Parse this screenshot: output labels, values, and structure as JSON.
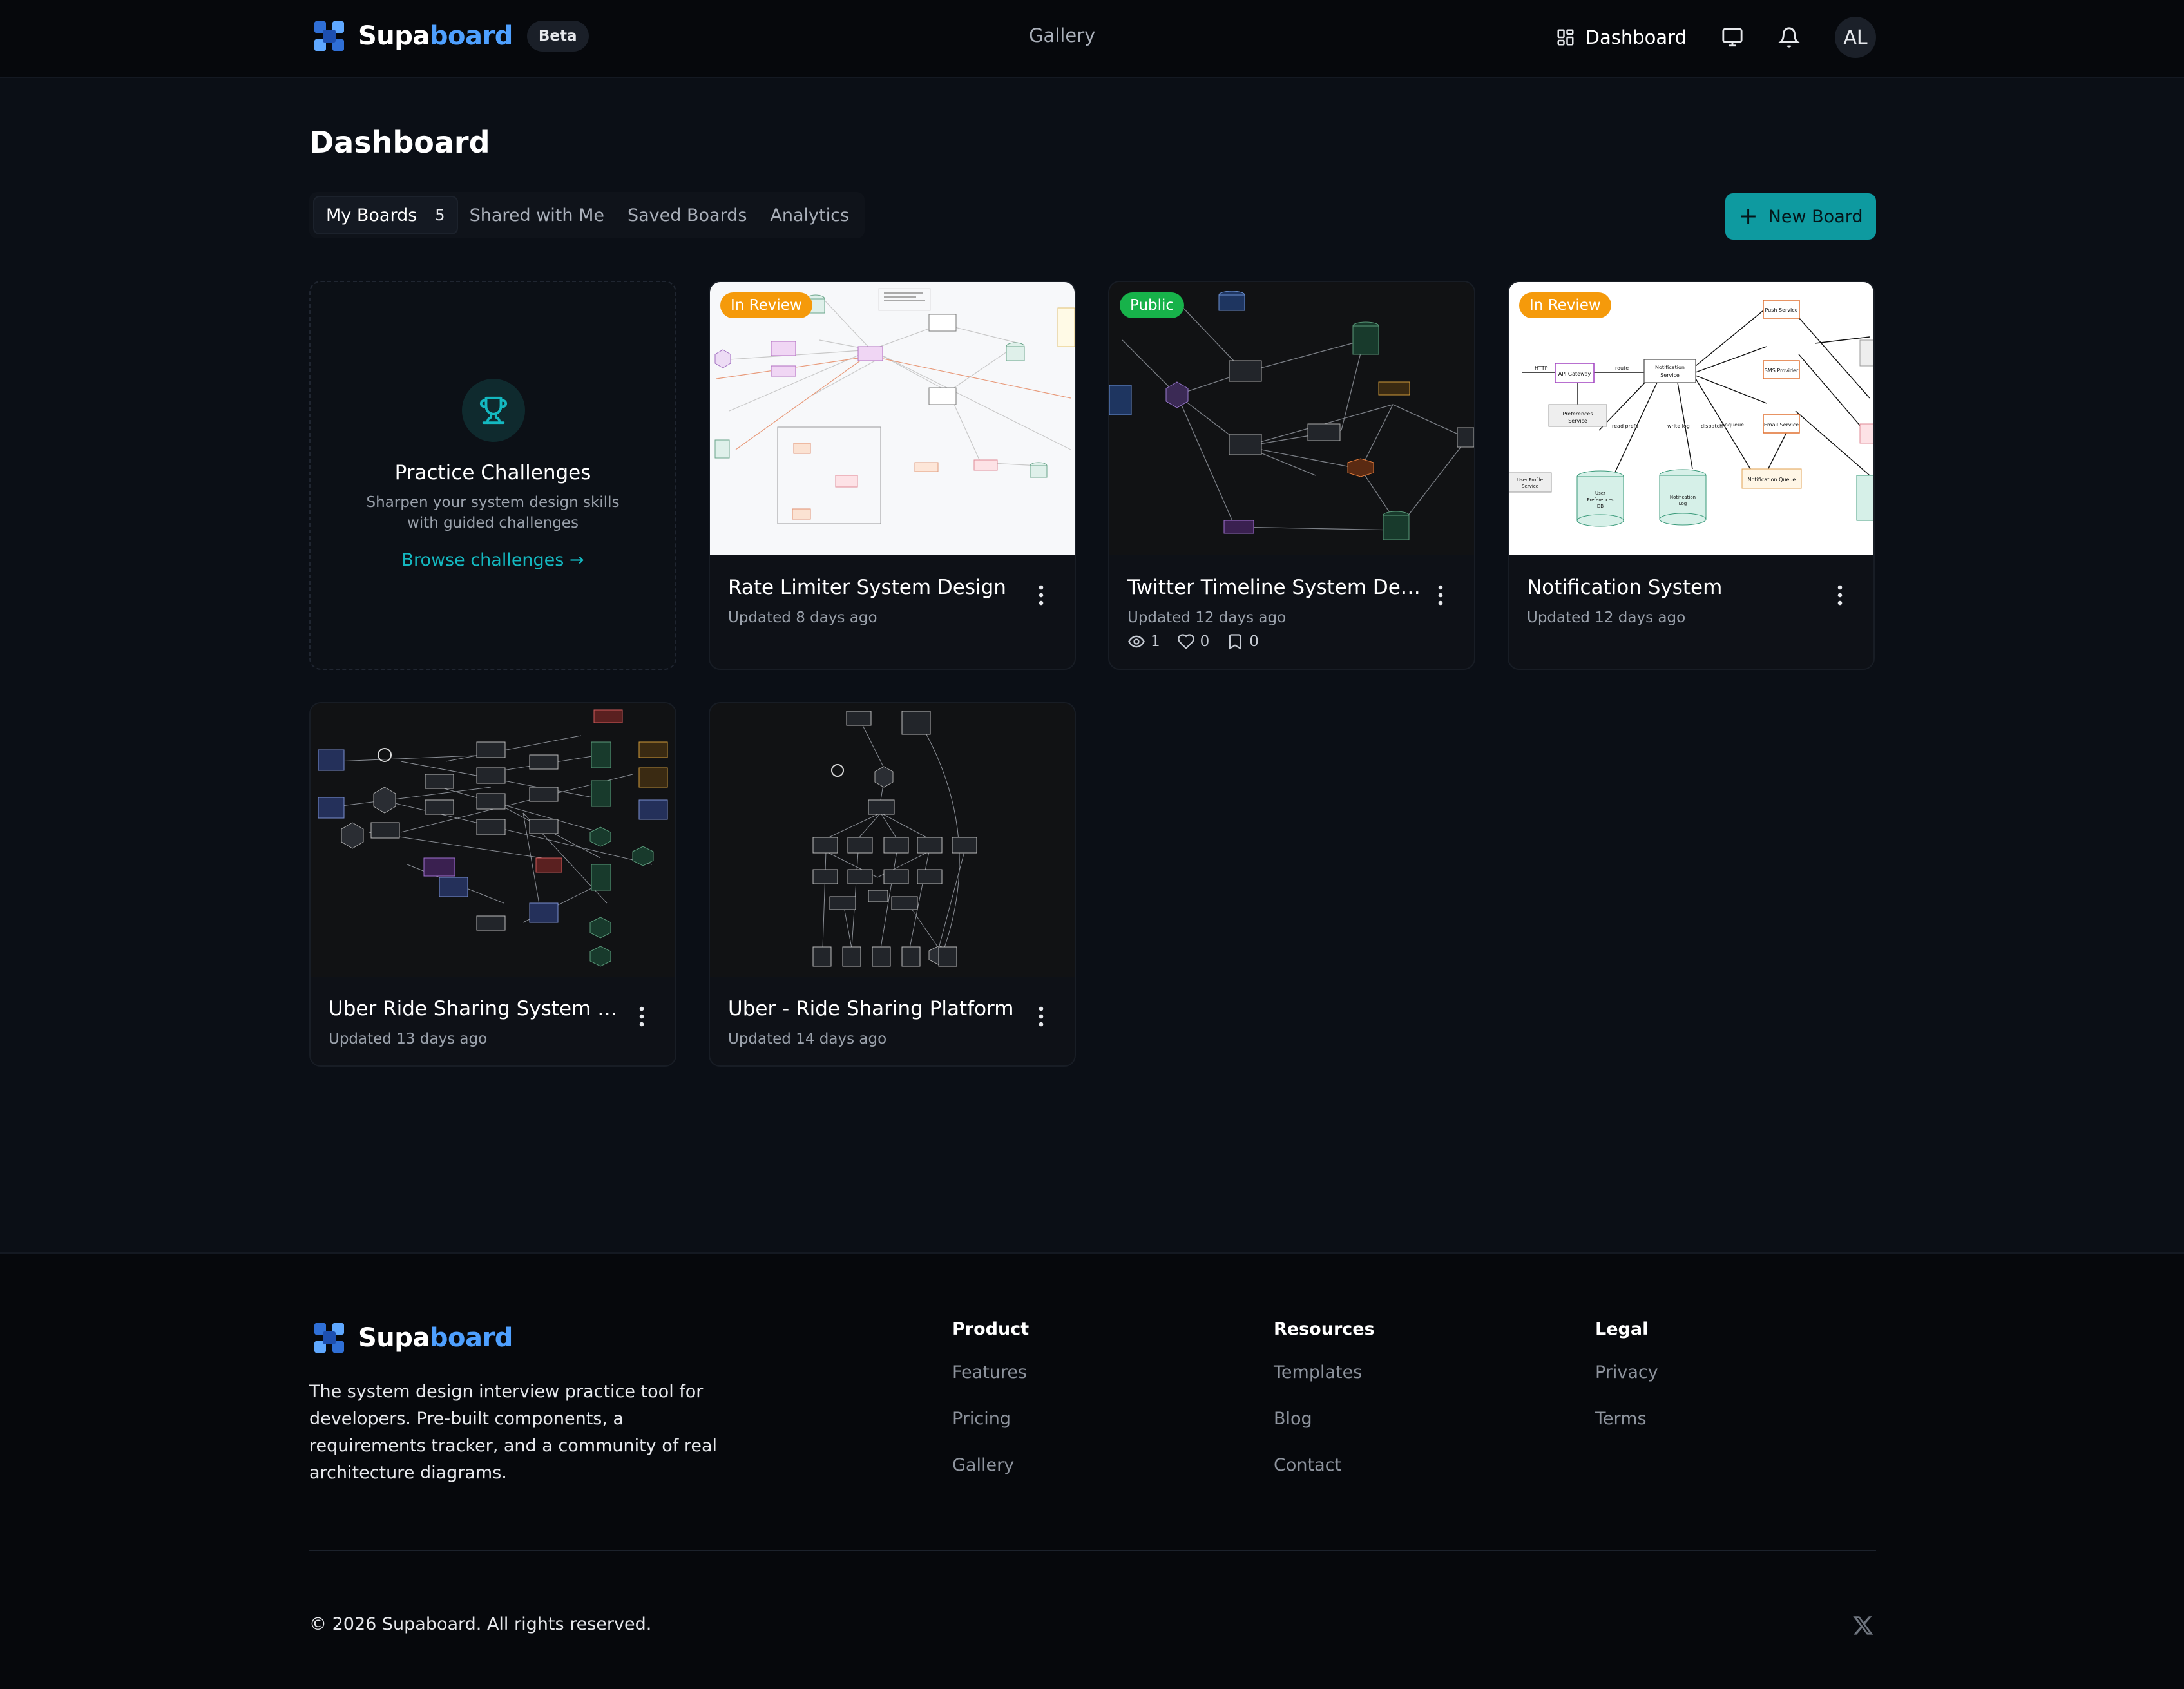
{
  "header": {
    "brand_a": "Supa",
    "brand_b": "board",
    "beta": "Beta",
    "gallery": "Gallery",
    "dashboard": "Dashboard",
    "avatar": "AL"
  },
  "page": {
    "title": "Dashboard",
    "tabs": [
      {
        "label": "My Boards",
        "count": "5"
      },
      {
        "label": "Shared with Me"
      },
      {
        "label": "Saved Boards"
      },
      {
        "label": "Analytics"
      }
    ],
    "new_board": "New Board"
  },
  "practice": {
    "title": "Practice Challenges",
    "desc": "Sharpen your system design skills with guided challenges",
    "link": "Browse challenges →"
  },
  "boards": [
    {
      "title": "Rate Limiter System Design",
      "updated": "Updated 8 days ago",
      "badge": "In Review"
    },
    {
      "title": "Twitter Timeline System Design",
      "updated": "Updated 12 days ago",
      "badge": "Public",
      "views": "1",
      "likes": "0",
      "saves": "0"
    },
    {
      "title": "Notification System",
      "updated": "Updated 12 days ago",
      "badge": "In Review"
    },
    {
      "title": "Uber Ride Sharing System Design",
      "updated": "Updated 13 days ago"
    },
    {
      "title": "Uber - Ride Sharing Platform",
      "updated": "Updated 14 days ago"
    }
  ],
  "thumb_labels": {
    "notif": [
      "Push Service",
      "API Gateway",
      "Notification Service",
      "SMS Provider",
      "Preferences Service",
      "Email Service",
      "User Profile Service",
      "User Preferences DB",
      "Notification Log",
      "Notification Queue",
      "HTTP",
      "route",
      "dispatch",
      "enqueue",
      "write log",
      "read prefs"
    ]
  },
  "footer": {
    "desc": "The system design interview practice tool for developers. Pre-built components, a requirements tracker, and a community of real architecture diagrams.",
    "product": {
      "heading": "Product",
      "links": [
        "Features",
        "Pricing",
        "Gallery"
      ]
    },
    "resources": {
      "heading": "Resources",
      "links": [
        "Templates",
        "Blog",
        "Contact"
      ]
    },
    "legal": {
      "heading": "Legal",
      "links": [
        "Privacy",
        "Terms"
      ]
    },
    "copyright": "© 2026 Supaboard. All rights reserved."
  },
  "colors": {
    "accent": "#0e9aa0",
    "review": "#f59a0b",
    "public": "#17b24a",
    "brand_blue": "#4ea0ff"
  }
}
